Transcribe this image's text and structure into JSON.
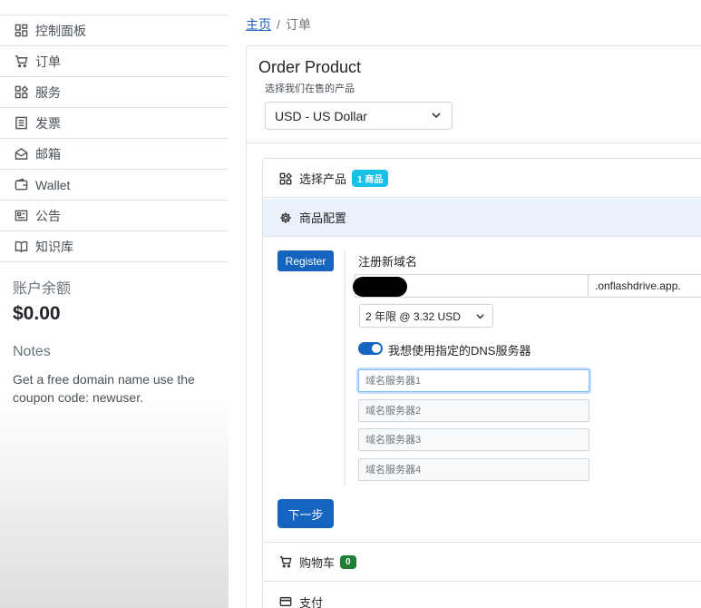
{
  "sidebar": {
    "items": [
      {
        "label": "控制面板",
        "icon": "dashboard-icon"
      },
      {
        "label": "订单",
        "icon": "cart-icon"
      },
      {
        "label": "服务",
        "icon": "services-icon"
      },
      {
        "label": "发票",
        "icon": "invoice-icon"
      },
      {
        "label": "邮箱",
        "icon": "mail-icon"
      },
      {
        "label": "Wallet",
        "icon": "wallet-icon"
      },
      {
        "label": "公告",
        "icon": "announcement-icon"
      },
      {
        "label": "知识库",
        "icon": "knowledgebase-icon"
      }
    ],
    "balance_label": "账户余额",
    "balance_value": "$0.00",
    "notes_label": "Notes",
    "notes_text": "Get a free domain name use the coupon code: newuser."
  },
  "breadcrumb": {
    "home": "主页",
    "current": "订单"
  },
  "main": {
    "title": "Order Product",
    "subtitle": "选择我们在售的产品",
    "currency": "USD - US Dollar",
    "steps": {
      "select_product": {
        "label": "选择产品",
        "badge": "1 商品"
      },
      "configure": {
        "label": "商品配置"
      },
      "cart": {
        "label": "购物车",
        "badge": "0"
      },
      "payment": {
        "label": "支付"
      }
    },
    "register_tab": "Register",
    "register_label": "注册新域名",
    "domain_value": "",
    "domain_suffix": ".onflashdrive.app.",
    "period_option": "2 年限 @ 3.32 USD",
    "dns_toggle_label": "我想使用指定的DNS服务器",
    "dns_toggle_on": true,
    "nameservers": [
      "域名服务器1",
      "域名服务器2",
      "域名服务器3",
      "域名服务器4"
    ],
    "next_button": "下一步"
  },
  "colors": {
    "primary": "#1565c0",
    "info_badge": "#17c1e8",
    "success_badge": "#1e7e34",
    "active_step_bg": "#eaf2fb"
  }
}
